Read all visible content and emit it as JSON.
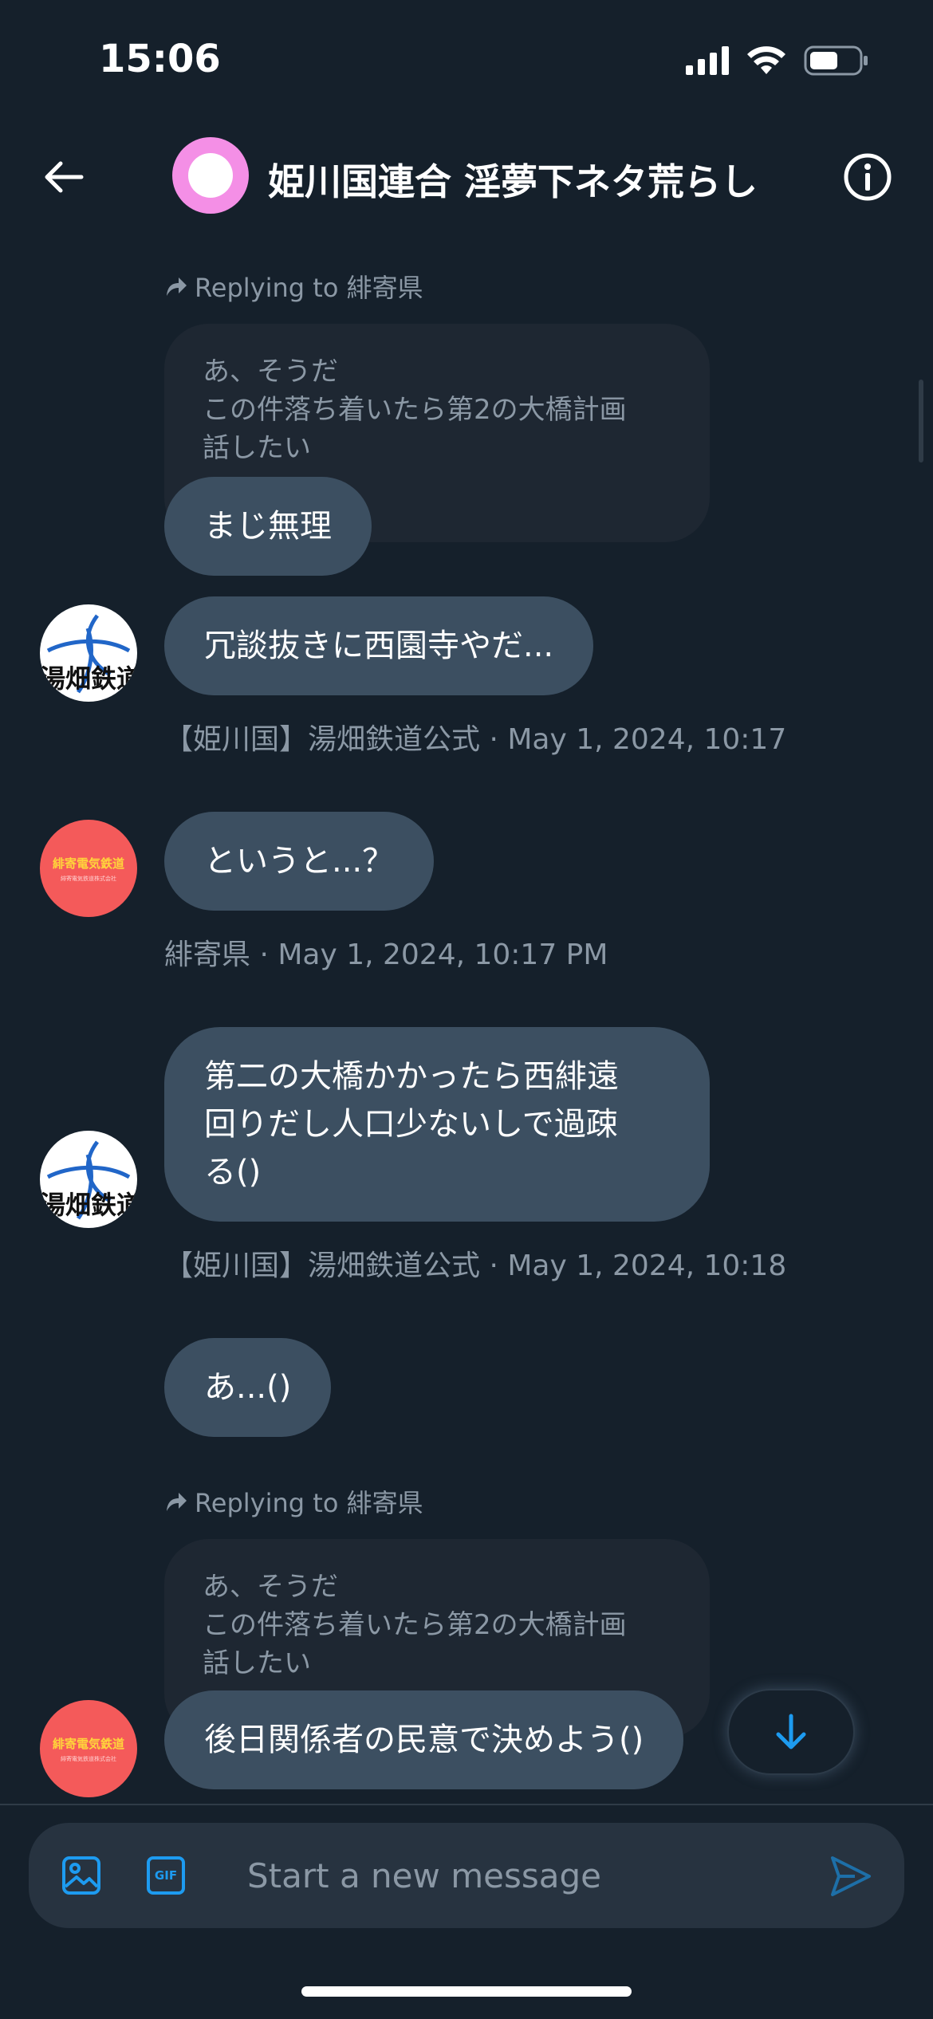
{
  "status_bar": {
    "time": "15:06"
  },
  "header": {
    "title": "姫川国連合 淫夢下ネタ荒らし"
  },
  "messages": [
    {
      "reply_to": "Replying to 緋寄県",
      "quoted_lines": [
        "あ、そうだ",
        "この件落ち着いたら第2の大橋計画",
        "話したい"
      ],
      "text": "まじ無理"
    },
    {
      "text": "冗談抜きに西園寺やだ...",
      "meta": "【姫川国】湯畑鉄道公式 · May 1, 2024, 10:17 PM",
      "avatar_text": "湯畑鉄道"
    },
    {
      "text": "というと...？",
      "meta": "緋寄県 · May 1, 2024, 10:17 PM",
      "avatar_text": "緋寄電気鉄道",
      "avatar_subtext": "緋寄電気鉄道株式会社"
    },
    {
      "text_lines": [
        "第二の大橋かかったら西緋遠",
        "回りだし人口少ないしで過疎",
        "る()"
      ],
      "meta": "【姫川国】湯畑鉄道公式 · May 1, 2024, 10:18 PM",
      "avatar_text": "湯畑鉄道"
    },
    {
      "text": "あ...()"
    },
    {
      "reply_to": "Replying to 緋寄県",
      "quoted_lines": [
        "あ、そうだ",
        "この件落ち着いたら第2の大橋計画",
        "話したい"
      ],
      "text": "後日関係者の民意で決めよう()",
      "avatar_text": "緋寄電気鉄道",
      "avatar_subtext": "緋寄電気鉄道株式会社"
    }
  ],
  "composer": {
    "placeholder": "Start a new message",
    "gif_label": "GIF"
  },
  "colors": {
    "accent": "#1d9bf0",
    "background": "#15202b",
    "bubble": "#3c4f61",
    "quoted": "#1e2732",
    "muted": "#8b98a5"
  },
  "icons": [
    "arrow-left-icon",
    "info-icon",
    "reply-arrow-icon",
    "arrow-down-icon",
    "image-icon",
    "gif-icon",
    "send-icon"
  ]
}
